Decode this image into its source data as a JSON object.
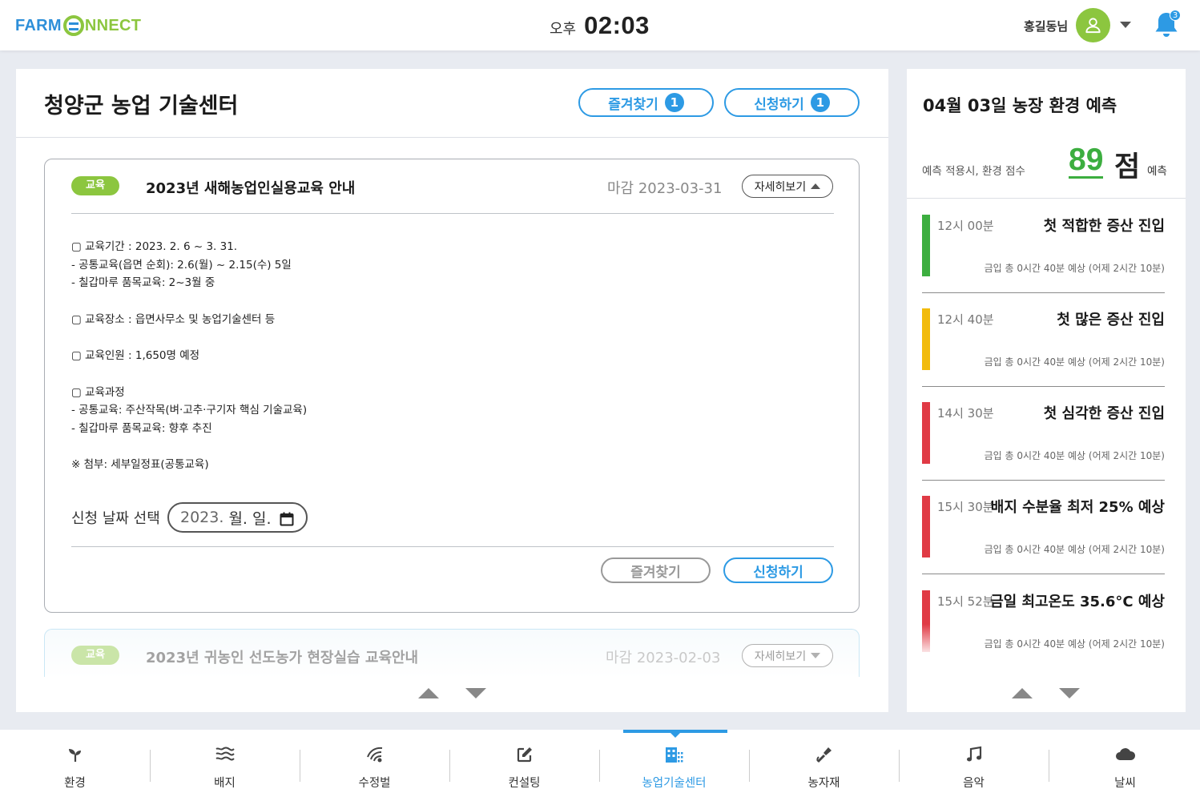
{
  "header": {
    "logo_left": "FARM",
    "logo_right": "NNECT",
    "ampm": "오후",
    "time": "02:03",
    "user_name": "홍길동님",
    "notification_count": "3"
  },
  "main": {
    "title": "청양군 농업 기술센터",
    "favorites_label": "즐겨찾기",
    "favorites_count": "1",
    "apply_label": "신청하기",
    "apply_count": "1",
    "card1": {
      "tag": "교육",
      "title": "2023년 새해농업인실용교육 안내",
      "deadline": "마감 2023-03-31",
      "detail_label": "자세히보기",
      "body": [
        "▢ 교육기간 : 2023. 2. 6 ~ 3. 31.",
        "- 공통교육(읍면 순회): 2.6(월) ~ 2.15(수) 5일",
        "- 칠갑마루 품목교육: 2~3월 중",
        "",
        "▢ 교육장소 : 읍면사무소 및 농업기술센터 등",
        "",
        "▢ 교육인원 : 1,650명 예정",
        "",
        "▢ 교육과정",
        "- 공통교육: 주산작목(벼·고추·구기자 핵심 기술교육)",
        "- 칠갑마루 품목교육: 향후 추진",
        "",
        "※ 첨부: 세부일정표(공통교육)"
      ],
      "date_label": "신청 날짜 선택",
      "date_year": "2023.",
      "date_rest": " 월. 일.",
      "fav_button": "즐겨찾기",
      "apply_button": "신청하기"
    },
    "card2": {
      "tag": "교육",
      "title": "2023년 귀농인 선도농가 현장실습 교육안내",
      "deadline": "마감 2023-02-03",
      "detail_label": "자세히보기"
    }
  },
  "side": {
    "title": "04월 03일 농장 환경 예측",
    "score_label": "예측 적용시, 환경 점수",
    "score": "89",
    "score_unit": "점",
    "score_suffix": "예측",
    "events": [
      {
        "time": "12시 00분",
        "title": "첫 적합한 증산 진입",
        "desc": "금입 총 0시간 40분 예상 (어제 2시간 10분)",
        "color": "#3cae3f"
      },
      {
        "time": "12시 40분",
        "title": "첫 많은 증산 진입",
        "desc": "금입 총 0시간 40분 예상 (어제 2시간 10분)",
        "color": "#f2bb0c"
      },
      {
        "time": "14시 30분",
        "title": "첫 심각한 증산 진입",
        "desc": "금입 총 0시간 40분 예상 (어제 2시간 10분)",
        "color": "#e03a45"
      },
      {
        "time": "15시 30분",
        "title": "배지 수분율 최저 25% 예상",
        "desc": "금입 총 0시간 40분 예상 (어제 2시간 10분)",
        "color": "#e03a45"
      },
      {
        "time": "15시 52분",
        "title": "금일 최고온도 35.6°C 예상",
        "desc": "금입 총 0시간 40분 예상 (어제 2시간 10분)",
        "color": "#e03a45"
      }
    ]
  },
  "nav": [
    {
      "label": "환경",
      "icon": "sprout-icon"
    },
    {
      "label": "배지",
      "icon": "waves-icon"
    },
    {
      "label": "수정벌",
      "icon": "bee-icon"
    },
    {
      "label": "컨설팅",
      "icon": "edit-icon"
    },
    {
      "label": "농업기술센터",
      "icon": "building-icon"
    },
    {
      "label": "농자재",
      "icon": "tool-icon"
    },
    {
      "label": "음악",
      "icon": "music-icon"
    },
    {
      "label": "날씨",
      "icon": "cloud-icon"
    }
  ],
  "colors": {
    "accent": "#2d9ae4",
    "brand_green": "#8cc63f",
    "score_green": "#3cae3f"
  }
}
